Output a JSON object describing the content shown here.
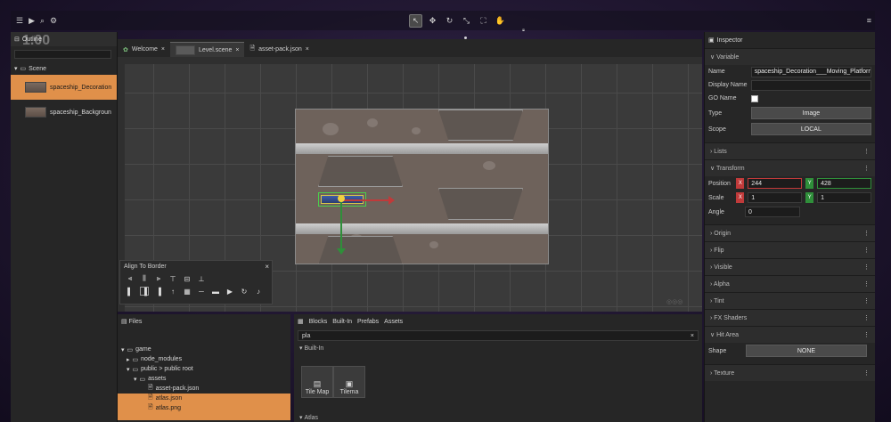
{
  "topbar": {
    "left_icons": [
      "menu-icon",
      "play-icon",
      "search-icon",
      "settings-icon"
    ],
    "center_icons": [
      "select-tool-icon",
      "translate-icon",
      "rotate-icon",
      "scale-icon",
      "resize-icon",
      "pan-icon"
    ],
    "right_icon": "hamburger-icon"
  },
  "outline": {
    "title": "Outline",
    "zoom_overlay": "1.00",
    "scene_label": "Scene",
    "items": [
      {
        "label": "spaceship_Decoration"
      },
      {
        "label": "spaceship_Backgroun"
      }
    ]
  },
  "editor_tabs": [
    {
      "label": "Welcome"
    },
    {
      "label": "Level.scene"
    },
    {
      "label": "asset-pack.json"
    }
  ],
  "align_panel": {
    "title": "Align To Border"
  },
  "files": {
    "title": "Files",
    "tree": [
      {
        "label": "game",
        "indent": 0
      },
      {
        "label": "node_modules",
        "indent": 1
      },
      {
        "label": "public > public root",
        "indent": 1
      },
      {
        "label": "assets",
        "indent": 2
      },
      {
        "label": "asset-pack.json",
        "indent": 3
      },
      {
        "label": "atlas.json",
        "indent": 3
      },
      {
        "label": "atlas.png",
        "indent": 3
      }
    ]
  },
  "blocks": {
    "tabs": [
      "Blocks",
      "Built-In",
      "Prefabs",
      "Assets"
    ],
    "search_value": "pla",
    "section_builtin": "Built-In",
    "cards": [
      {
        "label": "Tile Map"
      },
      {
        "label": "Tilema"
      }
    ],
    "section_atlas": "Atlas"
  },
  "inspector": {
    "title": "Inspector",
    "variable": {
      "header": "Variable",
      "name_label": "Name",
      "name_value": "spaceship_Decoration___Moving_Platforms",
      "display_name_label": "Display Name",
      "go_name_label": "GO Name",
      "type_label": "Type",
      "type_value": "Image",
      "scope_label": "Scope",
      "scope_value": "LOCAL"
    },
    "lists_header": "Lists",
    "transform": {
      "header": "Transform",
      "position_label": "Position",
      "position_x": "244",
      "position_y": "428",
      "scale_label": "Scale",
      "scale_x": "1",
      "scale_y": "1",
      "angle_label": "Angle",
      "angle_value": "0",
      "x_axis": "X",
      "y_axis": "Y"
    },
    "sections": [
      "Origin",
      "Flip",
      "Visible",
      "Alpha",
      "Tint",
      "FX Shaders"
    ],
    "hit_area": {
      "header": "Hit Area",
      "shape_label": "Shape",
      "shape_value": "NONE"
    },
    "texture_header": "Texture"
  },
  "colors": {
    "selection": "#e0904a",
    "axis_x": "#c03a3a",
    "axis_y": "#2f8f3a"
  }
}
